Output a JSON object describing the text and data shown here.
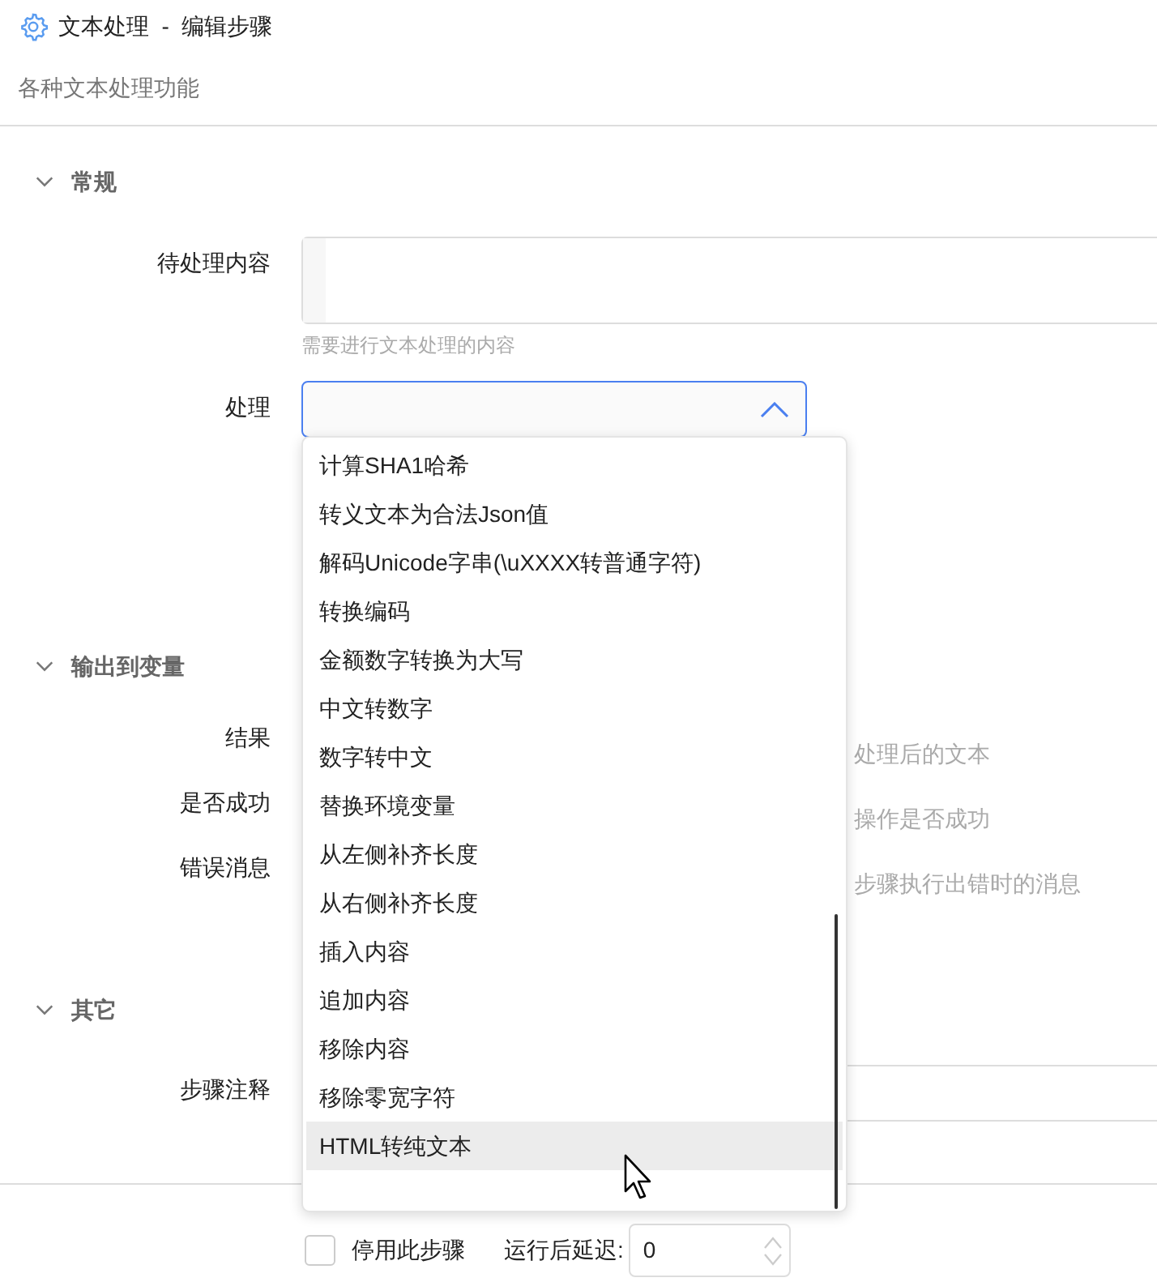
{
  "window": {
    "title": "文本处理  -  编辑步骤",
    "description": "各种文本处理功能"
  },
  "sections": [
    {
      "title": "常规",
      "expanded": true,
      "fields": [
        {
          "kind": "textarea",
          "label": "待处理内容",
          "hint": "需要进行文本处理的内容"
        },
        {
          "kind": "select",
          "label": "处理",
          "expanded": true
        }
      ]
    },
    {
      "title": "输出到变量",
      "expanded": true,
      "fields": [
        {
          "kind": "output",
          "label": "结果",
          "hint": "处理后的文本"
        },
        {
          "kind": "output",
          "label": "是否成功",
          "hint": "操作是否成功"
        },
        {
          "kind": "output",
          "label": "错误消息",
          "hint": "步骤执行出错时的消息"
        }
      ]
    },
    {
      "title": "其它",
      "expanded": true,
      "fields": [
        {
          "kind": "text",
          "label": "步骤注释"
        }
      ]
    }
  ],
  "dropdown": {
    "options": [
      {
        "label": "计算SHA1哈希",
        "highlighted": false
      },
      {
        "label": "转义文本为合法Json值",
        "highlighted": false
      },
      {
        "label": "解码Unicode字串(\\uXXXX转普通字符)",
        "highlighted": false
      },
      {
        "label": "转换编码",
        "highlighted": false
      },
      {
        "label": "金额数字转换为大写",
        "highlighted": false
      },
      {
        "label": "中文转数字",
        "highlighted": false
      },
      {
        "label": "数字转中文",
        "highlighted": false
      },
      {
        "label": "替换环境变量",
        "highlighted": false
      },
      {
        "label": "从左侧补齐长度",
        "highlighted": false
      },
      {
        "label": "从右侧补齐长度",
        "highlighted": false
      },
      {
        "label": "插入内容",
        "highlighted": false
      },
      {
        "label": "追加内容",
        "highlighted": false
      },
      {
        "label": "移除内容",
        "highlighted": false
      },
      {
        "label": "移除零宽字符",
        "highlighted": false
      },
      {
        "label": "HTML转纯文本",
        "highlighted": true
      }
    ]
  },
  "footer": {
    "disable_step": {
      "label": "停用此步骤",
      "checked": false
    },
    "delay": {
      "label": "运行后延迟:",
      "value": "0"
    }
  }
}
